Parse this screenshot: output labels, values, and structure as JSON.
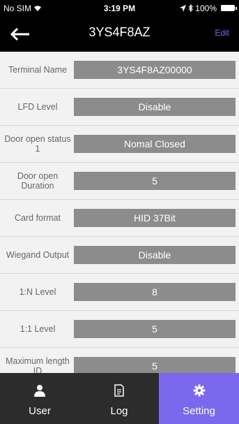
{
  "status_bar": {
    "carrier": "No SIM",
    "time": "3:19 PM",
    "battery": "100%"
  },
  "header": {
    "title": "3YS4F8AZ",
    "edit_label": "Edit"
  },
  "settings": [
    {
      "label": "Terminal Name",
      "value": "3YS4F8AZ00000"
    },
    {
      "label": "LFD Level",
      "value": "Disable"
    },
    {
      "label": "Door open status 1",
      "value": "Nomal Closed"
    },
    {
      "label": "Door open Duration",
      "value": "5"
    },
    {
      "label": "Card format",
      "value": "HID 37Bit"
    },
    {
      "label": "Wiegand Output",
      "value": "Disable"
    },
    {
      "label": "1:N Level",
      "value": "8"
    },
    {
      "label": "1:1 Level",
      "value": "5"
    },
    {
      "label": "Maximum length ID",
      "value": "5"
    }
  ],
  "tabs": [
    {
      "label": "User",
      "icon": "user-icon"
    },
    {
      "label": "Log",
      "icon": "log-icon"
    },
    {
      "label": "Setting",
      "icon": "gear-icon"
    }
  ],
  "colors": {
    "accent": "#7b68ee",
    "value_bg": "#8c8c8c",
    "tab_bg": "#2c2c2c"
  }
}
